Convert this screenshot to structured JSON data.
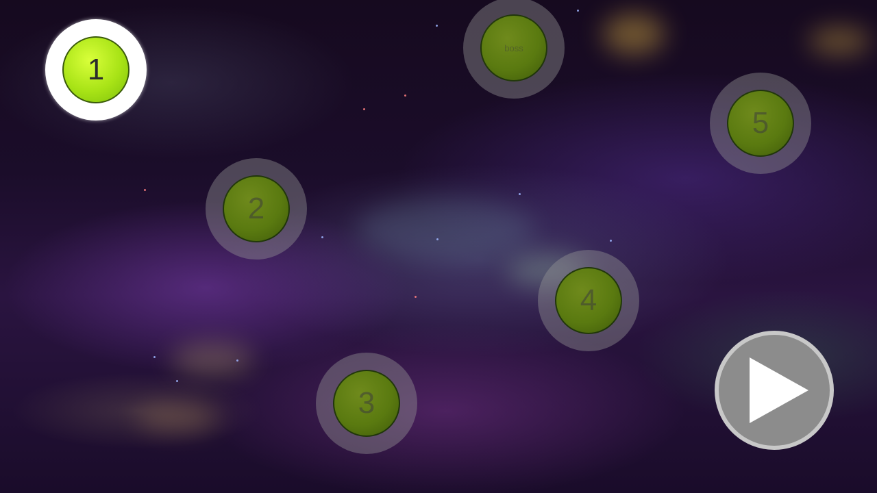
{
  "levels": [
    {
      "label": "1",
      "state": "unlocked"
    },
    {
      "label": "2",
      "state": "locked"
    },
    {
      "label": "3",
      "state": "locked"
    },
    {
      "label": "4",
      "state": "locked"
    },
    {
      "label": "5",
      "state": "locked"
    },
    {
      "label": "boss",
      "state": "locked"
    }
  ],
  "play_button": {
    "icon": "play-icon"
  },
  "colors": {
    "active_orb": "#a8e316",
    "locked_orb": "#5a7a10",
    "play_button": "#8c8c8c",
    "play_triangle": "#ffffff"
  }
}
